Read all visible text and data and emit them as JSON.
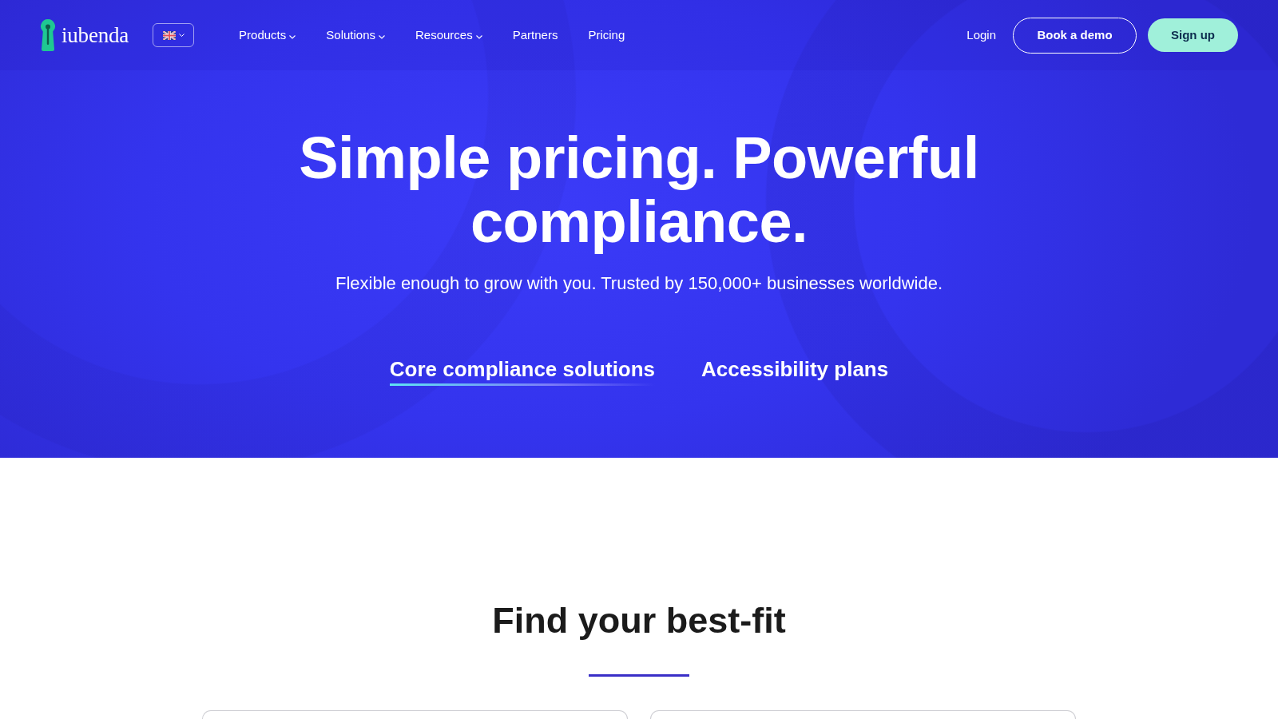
{
  "header": {
    "logo_text": "iubenda",
    "nav": [
      {
        "label": "Products",
        "dropdown": true
      },
      {
        "label": "Solutions",
        "dropdown": true
      },
      {
        "label": "Resources",
        "dropdown": true
      },
      {
        "label": "Partners",
        "dropdown": false
      },
      {
        "label": "Pricing",
        "dropdown": false
      }
    ],
    "login": "Login",
    "buttons": [
      {
        "label": "Book a demo",
        "kind": "outline"
      },
      {
        "label": "Sign up",
        "kind": "filled"
      }
    ]
  },
  "hero": {
    "title": "Simple pricing. Powerful compliance.",
    "subtitle": "Flexible enough to grow with you. Trusted by 150,000+ businesses worldwide.",
    "tabs": [
      {
        "label": "Core compliance solutions",
        "selected": true
      },
      {
        "label": "Accessibility plans",
        "selected": false
      }
    ]
  },
  "plans": {
    "heading": "Find your best-fit"
  }
}
